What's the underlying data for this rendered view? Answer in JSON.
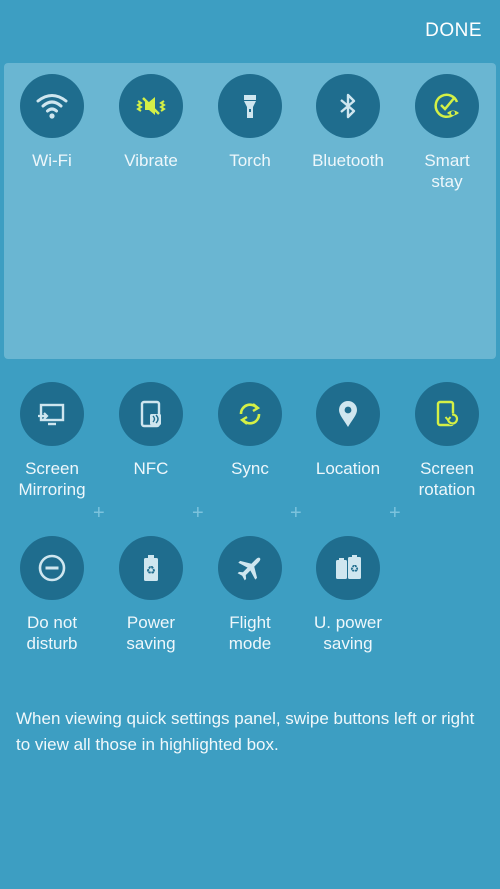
{
  "header": {
    "done_label": "DONE"
  },
  "colors": {
    "background": "#3d9ec2",
    "highlight_box": "#6ab6d2",
    "tile": "#1f6d8e",
    "active_icon": "#d4f046",
    "inactive_icon": "#cfe6ef"
  },
  "highlighted_tiles": [
    {
      "label": "Wi-Fi",
      "icon": "wifi-icon",
      "active": false
    },
    {
      "label": "Vibrate",
      "icon": "vibrate-icon",
      "active": true
    },
    {
      "label": "Torch",
      "icon": "torch-icon",
      "active": false
    },
    {
      "label": "Bluetooth",
      "icon": "bluetooth-icon",
      "active": false
    },
    {
      "label": "Smart\nstay",
      "icon": "smart-stay-icon",
      "active": true
    }
  ],
  "other_tiles": [
    {
      "label": "Screen\nMirroring",
      "icon": "screen-mirroring-icon",
      "active": false
    },
    {
      "label": "NFC",
      "icon": "nfc-icon",
      "active": false
    },
    {
      "label": "Sync",
      "icon": "sync-icon",
      "active": true
    },
    {
      "label": "Location",
      "icon": "location-icon",
      "active": false
    },
    {
      "label": "Screen\nrotation",
      "icon": "screen-rotation-icon",
      "active": true
    },
    {
      "label": "Do not\ndisturb",
      "icon": "do-not-disturb-icon",
      "active": false
    },
    {
      "label": "Power\nsaving",
      "icon": "power-saving-icon",
      "active": false
    },
    {
      "label": "Flight\nmode",
      "icon": "flight-mode-icon",
      "active": false
    },
    {
      "label": "U. power\nsaving",
      "icon": "ultra-power-saving-icon",
      "active": false
    }
  ],
  "hint": "When viewing quick settings panel, swipe buttons left or right to view all those in highlighted box."
}
